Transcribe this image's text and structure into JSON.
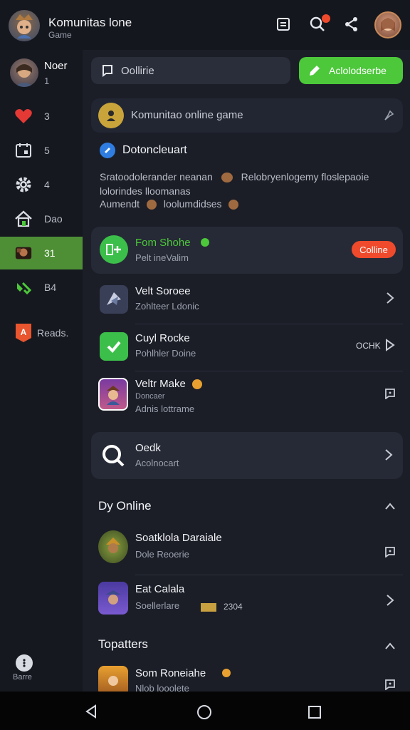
{
  "header": {
    "title": "Komunitas lone",
    "subtitle": "Game"
  },
  "sidebar": {
    "user": {
      "name": "Noer",
      "count": "1"
    },
    "items": [
      {
        "label": "3",
        "icon": "heart-icon"
      },
      {
        "label": "5",
        "icon": "calendar-icon"
      },
      {
        "label": "4",
        "icon": "gear-icon"
      },
      {
        "label": "Dao",
        "icon": "home-icon"
      },
      {
        "label": "31",
        "icon": "game-icon"
      },
      {
        "label": "B4",
        "icon": "gamepad-icon"
      },
      {
        "label": "Reads.",
        "icon": "badge-icon"
      }
    ],
    "bottom_label": "Barre"
  },
  "toolbar": {
    "search_placeholder": "Oollirie",
    "action_label": "Aclolodserbe"
  },
  "community": {
    "banner_text": "Komunitao online game",
    "post_author": "Dotoncleuart",
    "post_line1": "Sratoodolerander neanan",
    "post_line1b": "Relobryenlogemy floslepaoie",
    "post_line2": "lolorindes lloomanas",
    "post_line3": "Aumendt",
    "post_line3b": "loolumdidses"
  },
  "featured": {
    "title": "Fom Shohe",
    "subtitle": "Pelt ineValim",
    "status": "Colline"
  },
  "games": [
    {
      "title": "Velt Soroee",
      "subtitle": "Zohlteer Ldonic",
      "right": ""
    },
    {
      "title": "Cuyl Rocke",
      "subtitle": "Pohlhler Doine",
      "right": "OCHK"
    },
    {
      "title": "Veltr Make",
      "subtitle": "Adnis lottrame",
      "extra": "Doncaer",
      "right": ""
    }
  ],
  "search_card": {
    "title": "Oedk",
    "subtitle": "Acolnocart"
  },
  "sections": {
    "online_title": "Dy Online",
    "toplatters_title": "Topatters"
  },
  "online": [
    {
      "title": "Soatklola Daraiale",
      "subtitle": "Dole Reoerie"
    },
    {
      "title": "Eat Calala",
      "subtitle": "Soellerlare",
      "extra": "2304"
    }
  ],
  "toplatters": [
    {
      "title": "Som Roneiahe",
      "subtitle": "Nlob looolete"
    }
  ],
  "colors": {
    "accent": "#4cc83a",
    "active": "#4e8f36",
    "badge": "#ef4a2c"
  }
}
